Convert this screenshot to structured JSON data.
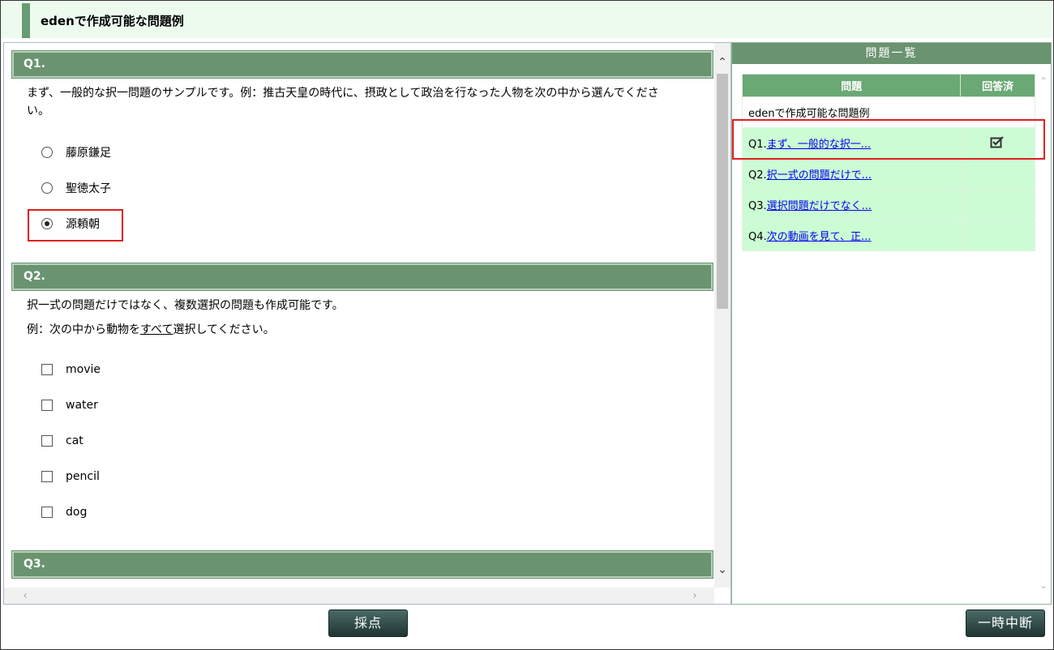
{
  "header": {
    "title": "edenで作成可能な問題例"
  },
  "questions": [
    {
      "label": "Q1.",
      "text_line1": "まず、一般的な択一問題のサンプルです。例：推古天皇の時代に、摂政として政治を行なった人物を次の中から選んでくださ",
      "text_line2": "い。",
      "options": [
        "藤原鎌足",
        "聖徳太子",
        "源頼朝"
      ],
      "selected_index": 2
    },
    {
      "label": "Q2.",
      "text_line1": "択一式の問題だけではなく、複数選択の問題も作成可能です。",
      "text_line2_prefix": "例：次の中から動物を",
      "text_line2_underline": "すべて",
      "text_line2_suffix": "選択してください。",
      "options": [
        "movie",
        "water",
        "cat",
        "pencil",
        "dog"
      ]
    },
    {
      "label": "Q3."
    }
  ],
  "sidebar": {
    "title": "問題一覧",
    "col_question": "問題",
    "col_answered": "回答済",
    "exam_title": "edenで作成可能な問題例",
    "items": [
      {
        "prefix": "Q1.",
        "link": "まず、一般的な択一...",
        "answered": true
      },
      {
        "prefix": "Q2.",
        "link": "択一式の問題だけで...",
        "answered": false
      },
      {
        "prefix": "Q3.",
        "link": "選択問題だけでなく...",
        "answered": false
      },
      {
        "prefix": "Q4.",
        "link": "次の動画を見て、正...",
        "answered": false
      }
    ]
  },
  "buttons": {
    "grade": "採点",
    "pause": "一時中断"
  },
  "icons": {
    "answered": "check-square-icon",
    "scroll_up": "chevron-up-icon",
    "scroll_down": "chevron-down-icon",
    "scroll_left": "chevron-left-icon",
    "scroll_right": "chevron-right-icon"
  },
  "colors": {
    "accent": "#6a9370",
    "highlight": "#e02020",
    "row_bg": "#ccfcd4",
    "header_bg": "#edfbee"
  }
}
